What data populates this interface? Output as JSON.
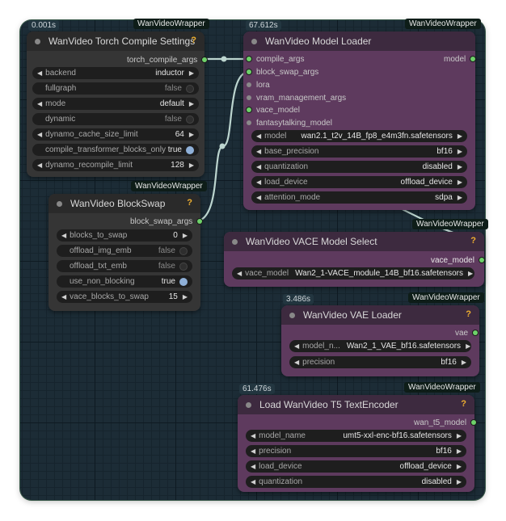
{
  "colors": {
    "link": "#bcd5cf",
    "slot_green": "#6ed16a",
    "help": "#f0b030"
  },
  "torch": {
    "timer": "0.001s",
    "badge": "WanVideoWrapper",
    "title": "WanVideo Torch Compile Settings",
    "help": "?",
    "output": "torch_compile_args",
    "widgets": [
      {
        "label": "backend",
        "value": "inductor"
      },
      {
        "label": "fullgraph",
        "value": "false"
      },
      {
        "label": "mode",
        "value": "default"
      },
      {
        "label": "dynamic",
        "value": "false"
      },
      {
        "label": "dynamo_cache_size_limit",
        "value": "64"
      },
      {
        "label": "compile_transformer_blocks_only",
        "value": "true"
      },
      {
        "label": "dynamo_recompile_limit",
        "value": "128"
      }
    ]
  },
  "blockswap": {
    "badge": "WanVideoWrapper",
    "title": "WanVideo BlockSwap",
    "help": "?",
    "output": "block_swap_args",
    "widgets": [
      {
        "label": "blocks_to_swap",
        "value": "0"
      },
      {
        "label": "offload_img_emb",
        "value": "false"
      },
      {
        "label": "offload_txt_emb",
        "value": "false"
      },
      {
        "label": "use_non_blocking",
        "value": "true"
      },
      {
        "label": "vace_blocks_to_swap",
        "value": "15"
      }
    ]
  },
  "loader": {
    "timer": "67.612s",
    "badge": "WanVideoWrapper",
    "title": "WanVideo Model Loader",
    "output": "model",
    "inputs": [
      "compile_args",
      "block_swap_args",
      "lora",
      "vram_management_args",
      "vace_model",
      "fantasytalking_model"
    ],
    "widgets": [
      {
        "label": "model",
        "value": "wan2.1_t2v_14B_fp8_e4m3fn.safetensors"
      },
      {
        "label": "base_precision",
        "value": "bf16"
      },
      {
        "label": "quantization",
        "value": "disabled"
      },
      {
        "label": "load_device",
        "value": "offload_device"
      },
      {
        "label": "attention_mode",
        "value": "sdpa"
      }
    ]
  },
  "vace": {
    "badge": "WanVideoWrapper",
    "title": "WanVideo VACE Model Select",
    "help": "?",
    "output": "vace_model",
    "widgets": [
      {
        "label": "vace_model",
        "value": "Wan2_1-VACE_module_14B_bf16.safetensors"
      }
    ]
  },
  "vae": {
    "timer": "3.486s",
    "badge": "WanVideoWrapper",
    "title": "WanVideo VAE Loader",
    "help": "?",
    "output": "vae",
    "widgets": [
      {
        "label": "model_n...",
        "value": "Wan2_1_VAE_bf16.safetensors"
      },
      {
        "label": "precision",
        "value": "bf16"
      }
    ]
  },
  "t5": {
    "timer": "61.476s",
    "badge": "WanVideoWrapper",
    "title": "Load WanVideo T5 TextEncoder",
    "help": "?",
    "output": "wan_t5_model",
    "widgets": [
      {
        "label": "model_name",
        "value": "umt5-xxl-enc-bf16.safetensors"
      },
      {
        "label": "precision",
        "value": "bf16"
      },
      {
        "label": "load_device",
        "value": "offload_device"
      },
      {
        "label": "quantization",
        "value": "disabled"
      }
    ]
  }
}
